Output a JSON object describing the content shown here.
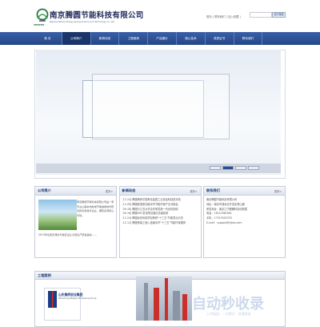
{
  "header": {
    "company_name": "南京腾圆节能科技有限公司",
    "company_name_en": "Nanjing Tenteo Energy Saving Science and Technology Co.,Ltd.",
    "logo_tag": "TENTEO",
    "top_links": "首页 | 联系我们 | 加入收藏 |",
    "search_button": "站内搜索"
  },
  "nav": {
    "items": [
      "首 页",
      "公司简介",
      "新闻动态",
      "工程案例",
      "产品展示",
      "核心技术",
      "资质证书",
      "联系我们"
    ],
    "active_index": 1
  },
  "about": {
    "title": "公司简介",
    "more": "更多>",
    "text_right": "南京腾圆节能科技有限公司是一家专业从事余热发电节能减排技术研究的高新技术企业，拥有多项核心专利。",
    "text_bottom": "2013年在南京溧水开发区设立大型生产研发基地……"
  },
  "news": {
    "title": "新闻动态",
    "more": "更多>",
    "items": [
      "[12-24] 腾圆荣获中国有色金属工业协会科技进步奖",
      "[12-09] 腾圆受邀参加南京市节能环保产业对接会",
      "[09-16] 腾圆与江苏大学合作研发新一代余热回收",
      "[09-16] 腾圆ORC发电项目通过省级验收",
      "[12-24] 腾圆余热利用项目荣获\"十三五\"节能重点示范",
      "[12-12] 腾圆承接工程入选南京市\"十三五\"节能环保推荐"
    ]
  },
  "contact": {
    "title": "联系我们",
    "more": "更多>",
    "lines": [
      "南京腾圆节能科技有限公司",
      "地址：南京市溧水区开发区秀山路",
      "研发地址：南京江宁麒麟科技创新园",
      "电话：18110981861",
      "手机：17313052333",
      "E-mail：support@njteo.com"
    ]
  },
  "projects": {
    "title": "工程案例",
    "card_name": "山东魏桥创业集团",
    "card_sub": "Shandong Weiqiao Pioneering Group"
  },
  "watermark": {
    "text": "自动秒收录",
    "sub": "上传链接 · 一次提交 · 快速收录"
  }
}
